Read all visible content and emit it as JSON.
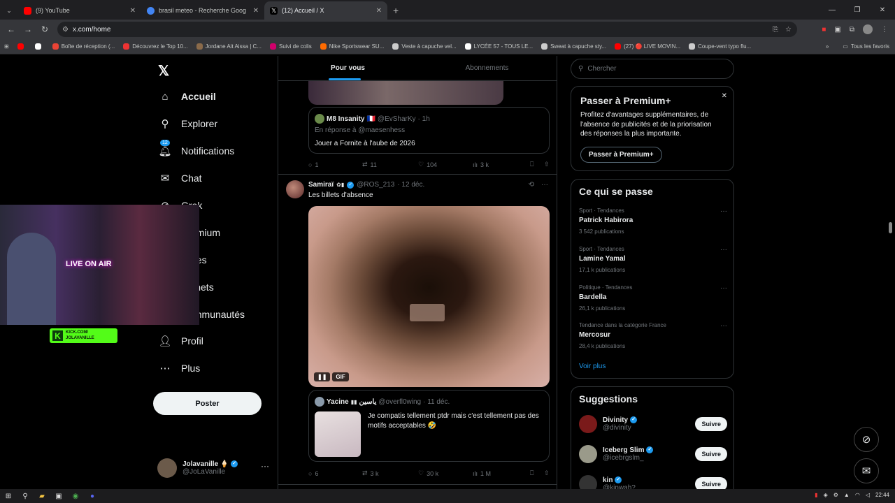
{
  "browser": {
    "tabs": [
      {
        "title": "(9) YouTube",
        "color": "#ff0000",
        "active": false
      },
      {
        "title": "brasil meteo - Recherche Goog",
        "color": "#4285f4",
        "active": false
      },
      {
        "title": "(12) Accueil / X",
        "color": "#ffffff",
        "active": true
      }
    ],
    "url": "x.com/home",
    "bookmarks": [
      {
        "label": "",
        "color": "#ff0000"
      },
      {
        "label": "",
        "color": "#ffffff"
      },
      {
        "label": "Boîte de réception (...",
        "color": "#ea4335"
      },
      {
        "label": "Découvrez le Top 10...",
        "color": "#e33"
      },
      {
        "label": "Jordane Ait Aissa | C...",
        "color": "#8a6a4a"
      },
      {
        "label": "Suivi de colis",
        "color": "#d1006b"
      },
      {
        "label": "Nike Sportswear SU...",
        "color": "#ff6b00"
      },
      {
        "label": "Veste à capuche vel...",
        "color": "#cccccc"
      },
      {
        "label": "LYCÉE 57 - TOUS LE...",
        "color": "#ffffff"
      },
      {
        "label": "Sweat à capuche sty...",
        "color": "#cccccc"
      },
      {
        "label": "(27) 🔴 LIVE MOVIN...",
        "color": "#ff0000"
      },
      {
        "label": "Coupe-vent typo flu...",
        "color": "#cccccc"
      }
    ],
    "bookmarks_all": "Tous les favoris"
  },
  "nav": {
    "items": [
      {
        "label": "Accueil",
        "icon": "home-icon"
      },
      {
        "label": "Explorer",
        "icon": "search-icon"
      },
      {
        "label": "Notifications",
        "icon": "bell-icon",
        "badge": "12"
      },
      {
        "label": "Chat",
        "icon": "mail-icon"
      },
      {
        "label": "Grok",
        "icon": "grok-icon"
      },
      {
        "label": "Premium",
        "icon": "x-icon"
      },
      {
        "label": "Listes",
        "icon": "list-icon"
      },
      {
        "label": "Signets",
        "icon": "bookmark-icon"
      },
      {
        "label": "Communautés",
        "icon": "people-icon"
      },
      {
        "label": "Profil",
        "icon": "user-icon"
      },
      {
        "label": "Plus",
        "icon": "more-icon"
      }
    ],
    "post_button": "Poster",
    "profile": {
      "name": "Jolavanille 🍦",
      "handle": "@JoLaVanille"
    }
  },
  "feed": {
    "tabs": [
      "Pour vous",
      "Abonnements"
    ],
    "quote1": {
      "name": "M8 Insanity",
      "flag": "🇫🇷",
      "handle": "@EvSharKy",
      "time": "· 1h",
      "reply_to": "En réponse à @maesenhess",
      "text": "Jouer a Fornite à l'aube de 2026"
    },
    "actions1": {
      "replies": "1",
      "retweets": "11",
      "likes": "104",
      "views": "3 k"
    },
    "tweet": {
      "name": "Samiraï",
      "handle": "@ROS_213",
      "time": "· 12 déc.",
      "text": "Les billets d'absence",
      "gif_label": "GIF"
    },
    "quote2": {
      "name": "Yacine",
      "arabic": "ياسين",
      "handle": "@overfl0wing",
      "time": "· 11 déc.",
      "text": "Je compatis tellement ptdr mais c'est tellement pas des motifs acceptables 🤣"
    },
    "actions2": {
      "replies": "6",
      "retweets": "3 k",
      "likes": "30 k",
      "views": "1 M"
    }
  },
  "right": {
    "search_placeholder": "Chercher",
    "premium": {
      "title": "Passer à Premium+",
      "text": "Profitez d'avantages supplémentaires, de l'absence de publicités et de la priorisation des réponses la plus importante.",
      "button": "Passer à Premium+"
    },
    "trends_title": "Ce qui se passe",
    "trends": [
      {
        "category": "Sport · Tendances",
        "name": "Patrick Habirora",
        "count": "3 542 publications"
      },
      {
        "category": "Sport · Tendances",
        "name": "Lamine Yamal",
        "count": "17,1 k publications"
      },
      {
        "category": "Politique · Tendances",
        "name": "Bardella",
        "count": "26,1 k publications"
      },
      {
        "category": "Tendance dans la catégorie France",
        "name": "Mercosur",
        "count": "28,4 k publications"
      }
    ],
    "show_more": "Voir plus",
    "suggestions_title": "Suggestions",
    "suggestions": [
      {
        "name": "Divinity",
        "handle": "@divinity",
        "button": "Suivre",
        "color": "#7a1a1a"
      },
      {
        "name": "Iceberg Slim",
        "handle": "@icebrgslm_",
        "button": "Suivre",
        "color": "#9a9a8a"
      },
      {
        "name": "kin",
        "handle": "@kinwah?",
        "button": "Suivre",
        "color": "#333333"
      }
    ]
  },
  "webcam": {
    "sign": "LIVE ON AIR",
    "kick_url": "KICK.COM/",
    "kick_user": "JOLAVANILLE"
  },
  "taskbar": {
    "time": "22:44"
  }
}
